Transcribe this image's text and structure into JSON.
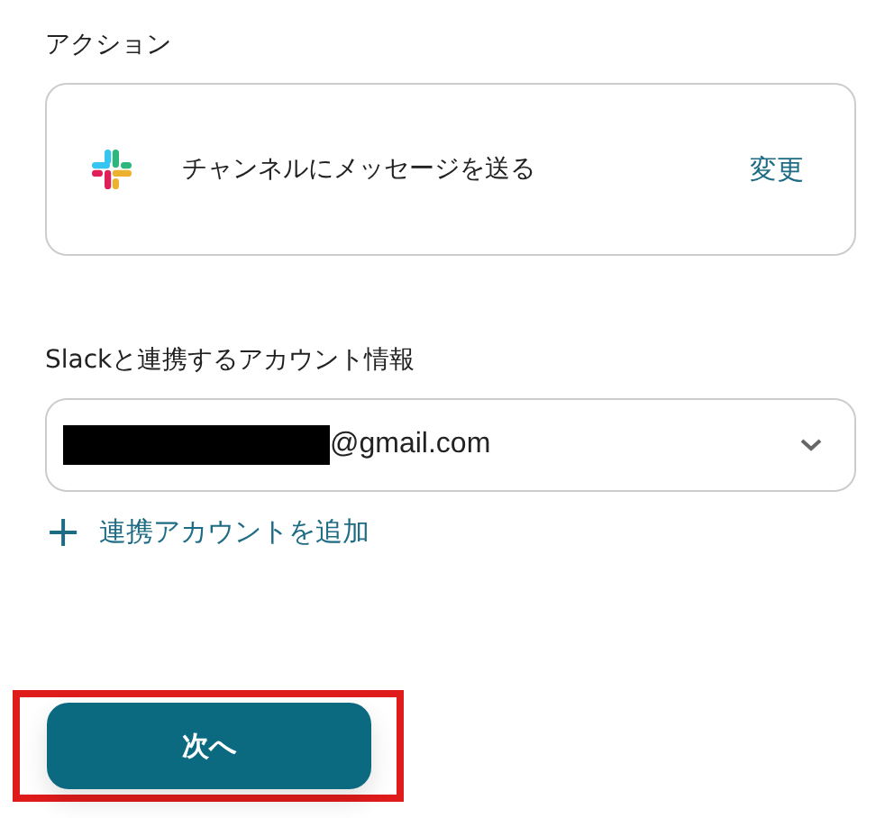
{
  "action_section": {
    "label": "アクション",
    "action": "チャンネルにメッセージを送る",
    "change_link": "変更"
  },
  "account_section": {
    "label": "Slackと連携するアカウント情報",
    "account_value": "@gmail.com",
    "redacted": true,
    "add_link": {
      "icon": "+",
      "label": "連携アカウントを追加"
    }
  },
  "next_button": {
    "label": "次へ",
    "highlighted": true
  }
}
